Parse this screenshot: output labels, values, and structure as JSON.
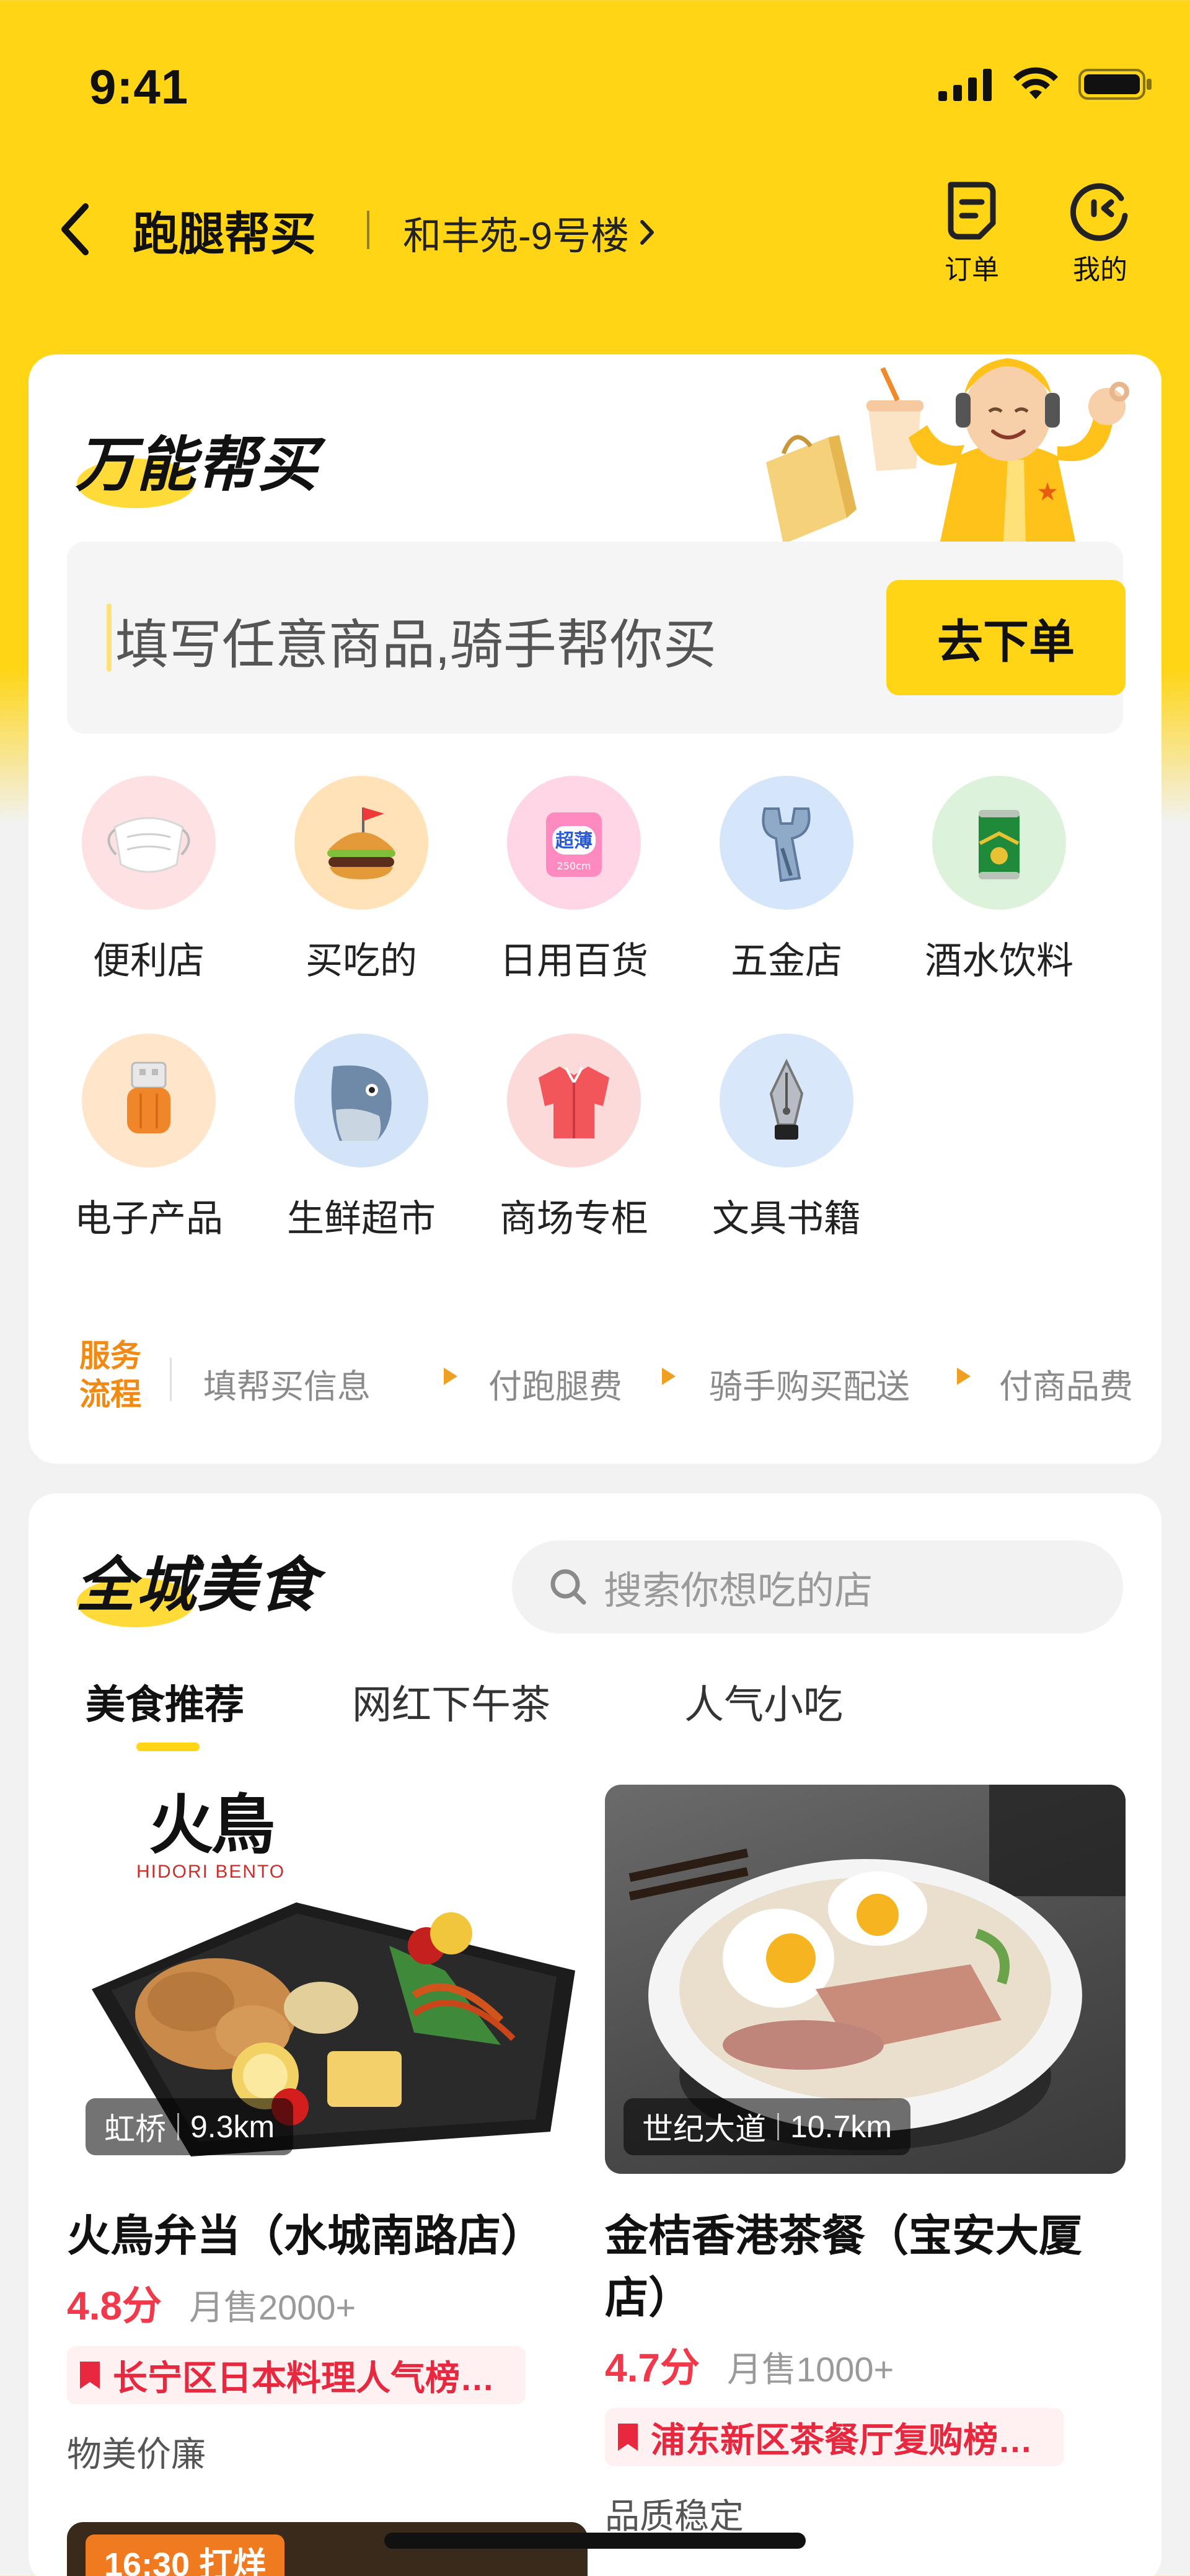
{
  "status_bar": {
    "time": "9:41"
  },
  "nav": {
    "title": "跑腿帮买",
    "address": "和丰苑-9号楼",
    "orders_label": "订单",
    "mine_label": "我的"
  },
  "buy_section": {
    "title": "万能帮买",
    "input_placeholder": "填写任意商品,骑手帮你买",
    "order_button": "去下单",
    "categories": [
      {
        "label": "便利店",
        "icon": "mask-icon"
      },
      {
        "label": "买吃的",
        "icon": "burger-icon"
      },
      {
        "label": "日用百货",
        "icon": "tissue-icon"
      },
      {
        "label": "五金店",
        "icon": "wrench-icon"
      },
      {
        "label": "酒水饮料",
        "icon": "beer-can-icon"
      },
      {
        "label": "电子产品",
        "icon": "charging-cable-icon"
      },
      {
        "label": "生鲜超市",
        "icon": "fish-icon"
      },
      {
        "label": "商场专柜",
        "icon": "shirt-icon"
      },
      {
        "label": "文具书籍",
        "icon": "fountain-pen-icon"
      }
    ],
    "flow_tag": "服务流程",
    "flow_steps": [
      "填帮买信息",
      "付跑腿费",
      "骑手购买配送",
      "付商品费"
    ]
  },
  "food_section": {
    "title": "全城美食",
    "search_placeholder": "搜索你想吃的店",
    "tabs": [
      "美食推荐",
      "网红下午茶",
      "人气小吃"
    ],
    "shops": [
      {
        "brand": "火鳥",
        "brand_sub": "HIDORI BENTO",
        "area": "虹桥",
        "distance": "9.3km",
        "name": "火鳥弁当（水城南路店）",
        "rating": "4.8分",
        "sales": "月售2000+",
        "rank": "长宁区日本料理人气榜…",
        "tagline": "物美价廉"
      },
      {
        "area": "世纪大道",
        "distance": "10.7km",
        "name": "金桔香港茶餐（宝安大厦店）",
        "rating": "4.7分",
        "sales": "月售1000+",
        "rank": "浦东新区茶餐厅复购榜…",
        "tagline": "品质稳定"
      }
    ],
    "next_card_badge": "16:30 打烊"
  },
  "colors": {
    "brand_yellow": "#FFD516",
    "rating_red": "#F2394B",
    "flow_orange": "#F08A12"
  }
}
